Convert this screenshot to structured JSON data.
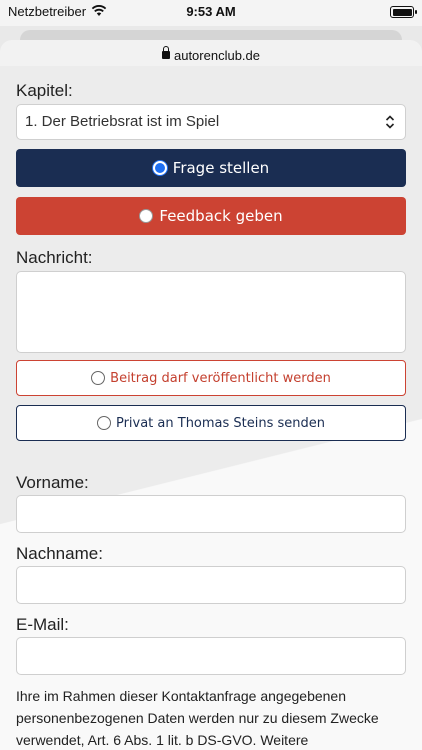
{
  "status": {
    "carrier": "Netzbetreiber",
    "time": "9:53 AM"
  },
  "browser": {
    "domain": "autorenclub.de"
  },
  "form": {
    "chapter_label": "Kapitel:",
    "chapter_value": "1. Der Betriebsrat ist im Spiel",
    "ask_label": "Frage stellen",
    "feedback_label": "Feedback geben",
    "message_label": "Nachricht:",
    "publish_label": "Beitrag darf veröffentlicht werden",
    "private_label": "Privat an Thomas Steins senden",
    "firstname_label": "Vorname:",
    "lastname_label": "Nachname:",
    "email_label": "E-Mail:",
    "privacy_notice": "Ihre im Rahmen dieser Kontaktanfrage angegebenen personenbezogenen Daten werden nur zu diesem Zwecke verwendet, Art. 6 Abs. 1 lit. b DS-GVO. Weitere"
  }
}
